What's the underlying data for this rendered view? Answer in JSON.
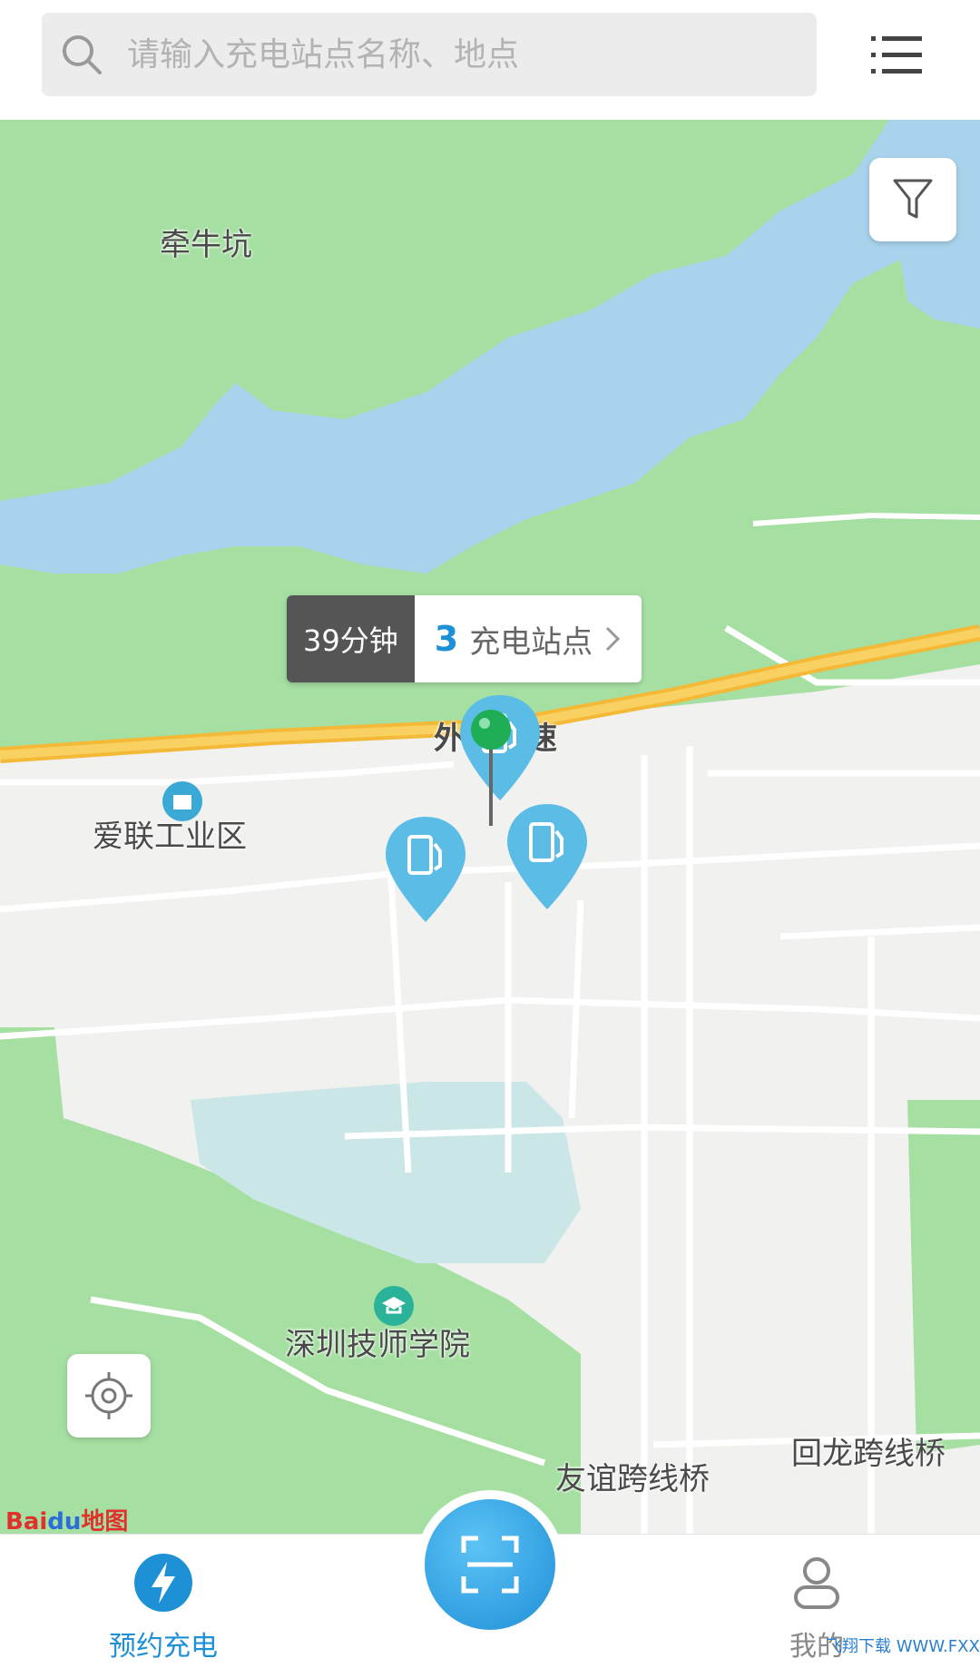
{
  "search": {
    "placeholder": "请输入充电站点名称、地点"
  },
  "map": {
    "labels": {
      "village": "牵牛坑",
      "highway": "外环高速",
      "industrial": "爱联工业区",
      "college": "深圳技师学院",
      "bridge1": "友谊跨线桥",
      "bridge2": "回龙跨线桥"
    },
    "callout": {
      "time": "39分钟",
      "count": "3",
      "stations_label": "充电站点"
    },
    "logo": {
      "bai": "Bai",
      "du": "du",
      "ditu": "地图"
    }
  },
  "colors": {
    "accent": "#1e90d6",
    "station_pin": "#5bbde6",
    "location_pin": "#1fae55"
  },
  "tabbar": {
    "left": {
      "label": "预约充电",
      "icon": "lightning-icon"
    },
    "center": {
      "icon": "scan-icon"
    },
    "right": {
      "label": "我的",
      "icon": "user-icon"
    }
  },
  "watermark": "飞翔下载 WWW.FXXZ.COM"
}
